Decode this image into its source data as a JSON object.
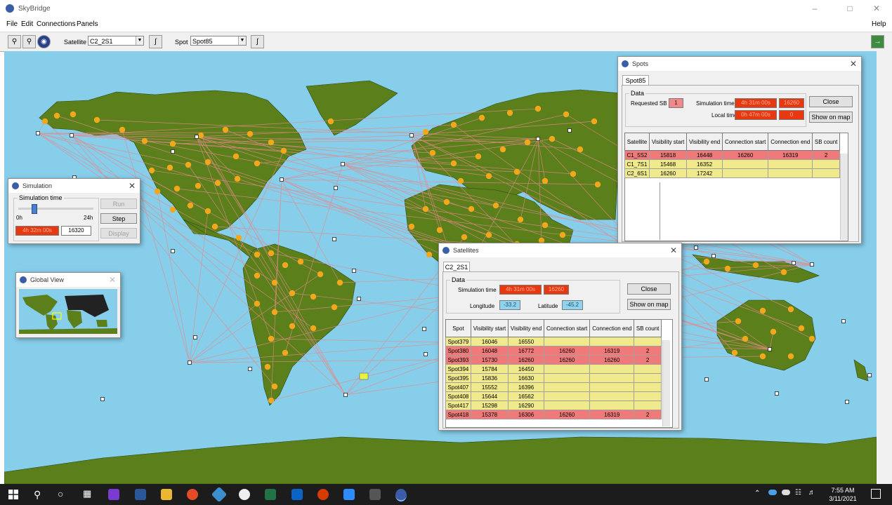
{
  "app": {
    "title": "SkyBridge"
  },
  "menu": {
    "file": "File",
    "edit": "Edit",
    "connections": "Connections",
    "panels": "Panels",
    "help": "Help"
  },
  "toolbar": {
    "satellite_label": "Satellite",
    "satellite_value": "C2_2S1",
    "spot_label": "Spot",
    "spot_value": "Spot85"
  },
  "simulation": {
    "title": "Simulation",
    "group_label": "Simulation time",
    "min_label": "0h",
    "max_label": "24h",
    "time_value": "4h 32m 00s",
    "step_value": "16320",
    "slider_fraction": 0.19,
    "run_label": "Run",
    "step_label": "Step",
    "display_label": "Display"
  },
  "global_view": {
    "title": "Global View"
  },
  "spots": {
    "title": "Spots",
    "tab": "Spot85",
    "data_label": "Data",
    "requested_sb_label": "Requested SB",
    "requested_sb_value": "1",
    "sim_time_label": "Simulation time",
    "sim_time_value": "4h 31m 00s",
    "sim_time_num": "16260",
    "local_time_label": "Local time",
    "local_time_value": "0h 47m 00s",
    "local_time_num": "0",
    "close_label": "Close",
    "show_map_label": "Show on map",
    "columns": [
      "Satellite",
      "Visibility start",
      "Visibility end",
      "Connection start",
      "Connection end",
      "SB count"
    ],
    "rows": [
      {
        "cells": [
          "C1_5S2",
          "15818",
          "16448",
          "16260",
          "16319",
          "2"
        ],
        "style": "r"
      },
      {
        "cells": [
          "C1_7S1",
          "15468",
          "16352",
          "",
          "",
          ""
        ],
        "style": "y"
      },
      {
        "cells": [
          "C2_6S1",
          "16260",
          "17242",
          "",
          "",
          ""
        ],
        "style": "y"
      }
    ]
  },
  "satellites": {
    "title": "Satellites",
    "tab": "C2_2S1",
    "data_label": "Data",
    "sim_time_label": "Simulation time",
    "sim_time_value": "4h 31m 00s",
    "sim_time_num": "16260",
    "longitude_label": "Longitude",
    "longitude_value": "-33.2",
    "latitude_label": "Latitude",
    "latitude_value": "-45.2",
    "close_label": "Close",
    "show_map_label": "Show on map",
    "columns": [
      "Spot",
      "Visibility start",
      "Visibility end",
      "Connection start",
      "Connection end",
      "SB count"
    ],
    "rows": [
      {
        "cells": [
          "Spot379",
          "16046",
          "16550",
          "",
          "",
          ""
        ],
        "style": "y"
      },
      {
        "cells": [
          "Spot380",
          "16048",
          "16772",
          "16260",
          "16319",
          "2"
        ],
        "style": "r"
      },
      {
        "cells": [
          "Spot393",
          "15730",
          "16260",
          "16260",
          "16260",
          "2"
        ],
        "style": "r"
      },
      {
        "cells": [
          "Spot394",
          "15784",
          "16450",
          "",
          "",
          ""
        ],
        "style": "y"
      },
      {
        "cells": [
          "Spot395",
          "15836",
          "16630",
          "",
          "",
          ""
        ],
        "style": "y"
      },
      {
        "cells": [
          "Spot407",
          "15552",
          "16396",
          "",
          "",
          ""
        ],
        "style": "y"
      },
      {
        "cells": [
          "Spot408",
          "15644",
          "16562",
          "",
          "",
          ""
        ],
        "style": "y"
      },
      {
        "cells": [
          "Spot417",
          "15298",
          "16290",
          "",
          "",
          ""
        ],
        "style": "y"
      },
      {
        "cells": [
          "Spot418",
          "15378",
          "16306",
          "16260",
          "16319",
          "2"
        ],
        "style": "r"
      }
    ]
  },
  "taskbar": {
    "time": "7:55 AM",
    "date": "3/11/2021"
  },
  "colors": {
    "ocean": "#87ceeb",
    "land": "#5b7f1a",
    "spot": "#f2a71c",
    "link": "#e38a8a",
    "highlight": "#e8380f"
  },
  "icons": [
    "zoom-in-icon",
    "zoom-out-icon",
    "globe-icon",
    "chart-icon",
    "exit-icon"
  ]
}
